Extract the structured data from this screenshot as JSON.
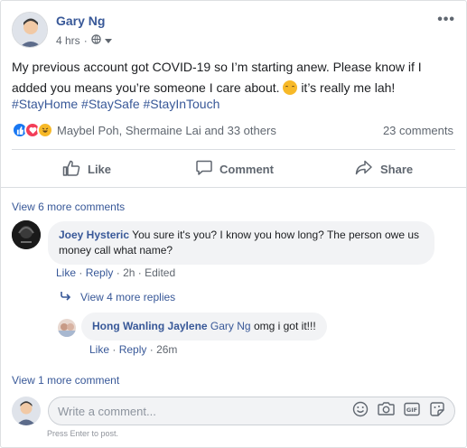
{
  "post": {
    "author": "Gary Ng",
    "time": "4 hrs",
    "text": "My previous account got COVID-19 so I’m starting anew. Please know if I added you means you’re someone I care about.",
    "text_after_emoji": "it’s really me lah!",
    "hashtags": "#StayHome #StaySafe #StayInTouch",
    "reactors": "Maybel Poh, Shermaine Lai and 33 others",
    "comment_count": "23 comments"
  },
  "actions": {
    "like": "Like",
    "comment": "Comment",
    "share": "Share"
  },
  "comments": {
    "view_more_top": "View 6 more comments",
    "first": {
      "author": "Joey Hysteric",
      "text": "You sure it's you? I know you how long? The person owe us money call what name?",
      "like": "Like",
      "reply": "Reply",
      "time": "2h",
      "edited": "Edited"
    },
    "view_more_replies": "View 4 more replies",
    "reply": {
      "author": "Hong Wanling Jaylene",
      "tag": "Gary Ng",
      "text": "omg i got it!!!",
      "like": "Like",
      "reply": "Reply",
      "time": "26m"
    },
    "view_more_bottom": "View 1 more comment"
  },
  "composer": {
    "placeholder": "Write a comment...",
    "hint": "Press Enter to post."
  },
  "colors": {
    "link": "#385898",
    "secondary_text": "#606770",
    "like_blue": "#1877f2",
    "love_red": "#f33e58",
    "haha_yellow": "#f7b928"
  }
}
